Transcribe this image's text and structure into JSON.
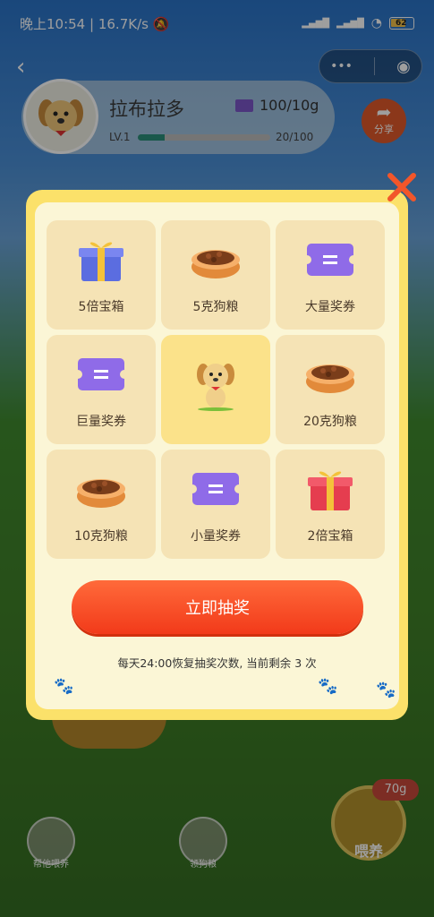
{
  "status_bar": {
    "time": "晚上10:54",
    "speed": "16.7K/s",
    "battery": "62"
  },
  "header": {
    "more_icon": "•••"
  },
  "profile": {
    "name": "拉布拉多",
    "tickets": "100/10g",
    "level": "LV.1",
    "xp": "20/100",
    "xp_progress": 0.2
  },
  "share": {
    "label": "分享"
  },
  "prizes": [
    {
      "label": "5倍宝箱",
      "icon": "gift-box-blue-icon"
    },
    {
      "label": "5克狗粮",
      "icon": "dog-food-bowl-icon"
    },
    {
      "label": "大量奖券",
      "icon": "purple-ticket-icon"
    },
    {
      "label": "巨量奖券",
      "icon": "purple-ticket-icon"
    },
    {
      "label": "",
      "icon": "puppy-icon"
    },
    {
      "label": "20克狗粮",
      "icon": "dog-food-bowl-icon"
    },
    {
      "label": "10克狗粮",
      "icon": "dog-food-bowl-icon"
    },
    {
      "label": "小量奖券",
      "icon": "purple-ticket-icon"
    },
    {
      "label": "2倍宝箱",
      "icon": "gift-box-red-icon"
    }
  ],
  "draw": {
    "button_label": "立即抽奖",
    "note": "每天24:00恢复抽奖次数, 当前剩余 3 次"
  },
  "bottom": {
    "help_feed": "帮他喂养",
    "get_food": "领狗粮",
    "feed": "喂养",
    "food_amount": "70g"
  },
  "colors": {
    "accent": "#f23a1a",
    "modal_border": "#fbe16a",
    "cell": "#f5e3b5",
    "ticket": "#7b56c8"
  }
}
